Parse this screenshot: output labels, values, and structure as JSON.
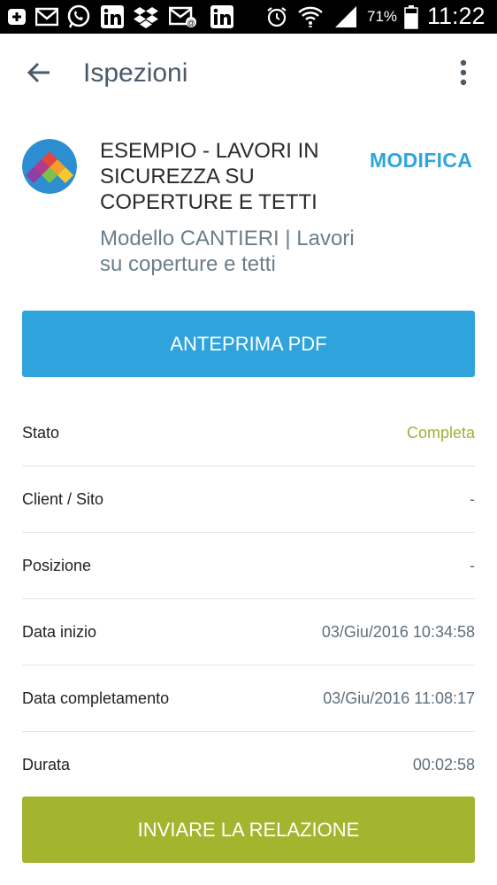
{
  "status_bar": {
    "battery_percent": "71%",
    "time": "11:22",
    "icons": [
      "add-box-icon",
      "mail-icon",
      "whatsapp-icon",
      "linkedin-icon",
      "dropbox-icon",
      "email-notification-icon",
      "linkedin-icon",
      "alarm-icon",
      "wifi-icon",
      "signal-icon",
      "battery-icon"
    ]
  },
  "app_bar": {
    "title": "Ispezioni",
    "back_icon": "arrow-back-icon",
    "menu_icon": "more-vert-icon"
  },
  "inspection": {
    "title": "ESEMPIO - LAVORI IN SICUREZZA SU COPERTURE E TETTI",
    "subtitle": "Modello CANTIERI | Lavori su coperture e tetti",
    "edit_label": "MODIFICA"
  },
  "actions": {
    "pdf_label": "ANTEPRIMA PDF",
    "send_label": "INVIARE LA RELAZIONE"
  },
  "details": [
    {
      "label": "Stato",
      "value": "Completa"
    },
    {
      "label": "Client / Sito",
      "value": "-"
    },
    {
      "label": "Posizione",
      "value": "-"
    },
    {
      "label": "Data inizio",
      "value": "03/Giu/2016 10:34:58"
    },
    {
      "label": "Data completamento",
      "value": "03/Giu/2016 11:08:17"
    },
    {
      "label": "Durata",
      "value": "00:02:58"
    }
  ],
  "colors": {
    "accent_blue": "#2fa3db",
    "accent_green": "#a3b52f",
    "status_ok": "#9bb332"
  }
}
